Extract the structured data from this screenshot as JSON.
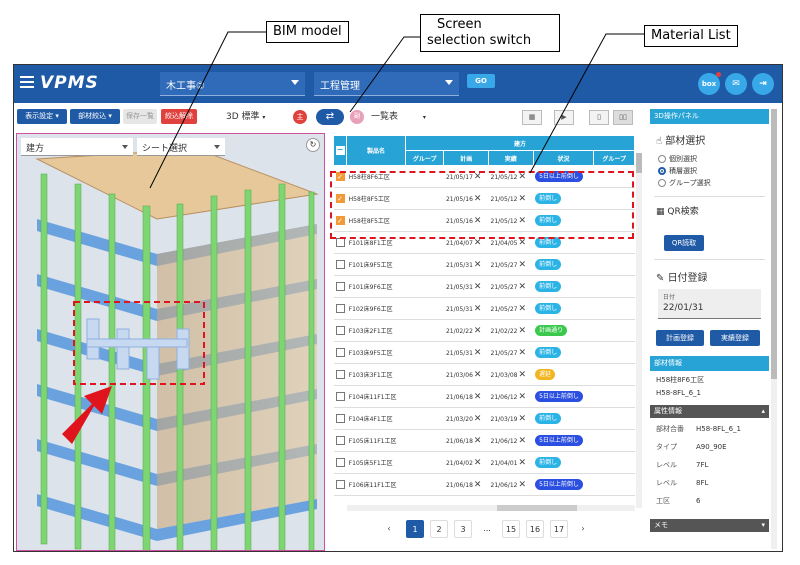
{
  "callouts": {
    "bim": "BIM model",
    "switch_line1": "Screen",
    "switch_line2": "selection switch",
    "material": "Material List"
  },
  "header": {
    "logo": "VPMS",
    "project": "木工事②",
    "module": "工程管理",
    "go": "GO",
    "box": "box"
  },
  "toolbar": {
    "display_settings": "表示設定",
    "member_filter": "部材絞込",
    "save_list": "保存一覧",
    "clear_filter": "絞込解除",
    "view_mode": "3D 標準",
    "badge_main": "主",
    "badge_sub": "副",
    "list_mode": "一覧表"
  },
  "viewport": {
    "dir_select": "建方",
    "sheet_select": "シート選択"
  },
  "table": {
    "group_header": "建方",
    "col_name": "製品名",
    "col_group": "グループ",
    "col_plan": "計画",
    "col_actual": "実績",
    "col_status": "状況",
    "col_group2": "グループ",
    "rows": [
      {
        "name": "H58柱8F6工区",
        "plan": "21/05/17",
        "actual": "21/05/12",
        "status": "5日以上前倒し",
        "checked": true,
        "color": "blue"
      },
      {
        "name": "H58柱8F5工区",
        "plan": "21/05/16",
        "actual": "21/05/12",
        "status": "前倒し",
        "checked": true,
        "color": "cyan"
      },
      {
        "name": "H58柱8F5工区",
        "plan": "21/05/16",
        "actual": "21/05/12",
        "status": "前倒し",
        "checked": true,
        "color": "cyan"
      },
      {
        "name": "F101床8F1工区",
        "plan": "21/04/07",
        "actual": "21/04/05",
        "status": "前倒し",
        "checked": false,
        "color": "cyan"
      },
      {
        "name": "F101床9F5工区",
        "plan": "21/05/31",
        "actual": "21/05/27",
        "status": "前倒し",
        "checked": false,
        "color": "cyan"
      },
      {
        "name": "F101床9F6工区",
        "plan": "21/05/31",
        "actual": "21/05/27",
        "status": "前倒し",
        "checked": false,
        "color": "cyan"
      },
      {
        "name": "F102床9F6工区",
        "plan": "21/05/31",
        "actual": "21/05/27",
        "status": "前倒し",
        "checked": false,
        "color": "cyan"
      },
      {
        "name": "F103床2F1工区",
        "plan": "21/02/22",
        "actual": "21/02/22",
        "status": "計画通り",
        "checked": false,
        "color": "green"
      },
      {
        "name": "F103床9F5工区",
        "plan": "21/05/31",
        "actual": "21/05/27",
        "status": "前倒し",
        "checked": false,
        "color": "cyan"
      },
      {
        "name": "F103床3F1工区",
        "plan": "21/03/06",
        "actual": "21/03/08",
        "status": "遅延",
        "checked": false,
        "color": "yellow"
      },
      {
        "name": "F104床11F1工区",
        "plan": "21/06/18",
        "actual": "21/06/12",
        "status": "5日以上前倒し",
        "checked": false,
        "color": "blue"
      },
      {
        "name": "F104床4F1工区",
        "plan": "21/03/20",
        "actual": "21/03/19",
        "status": "前倒し",
        "checked": false,
        "color": "cyan"
      },
      {
        "name": "F105床11F1工区",
        "plan": "21/06/18",
        "actual": "21/06/12",
        "status": "5日以上前倒し",
        "checked": false,
        "color": "blue"
      },
      {
        "name": "F105床5F1工区",
        "plan": "21/04/02",
        "actual": "21/04/01",
        "status": "前倒し",
        "checked": false,
        "color": "cyan"
      },
      {
        "name": "F106床11F1工区",
        "plan": "21/06/18",
        "actual": "21/06/12",
        "status": "5日以上前倒し",
        "checked": false,
        "color": "blue"
      }
    ]
  },
  "pager": {
    "pages": [
      "1",
      "2",
      "3",
      "...",
      "15",
      "16",
      "17"
    ],
    "current": "1",
    "prev": "‹",
    "next": "›"
  },
  "panel": {
    "title": "3D操作パネル",
    "member_select": "部材選択",
    "radio1": "個別選択",
    "radio2": "積層選択",
    "radio3": "グループ選択",
    "qr_search": "QR検索",
    "qr_read": "QR読取",
    "date_reg": "日付登録",
    "date_label": "日付",
    "date_value": "22/01/31",
    "plan_reg": "計画登録",
    "actual_reg": "実績登録",
    "member_info": "部材情報",
    "info1": "H58柱8F6工区",
    "info2": "H58-8FL_6_1",
    "attr_info": "属性情報",
    "attrs": [
      {
        "k": "部材合番",
        "v": "H58-8FL_6_1"
      },
      {
        "k": "タイプ",
        "v": "A90_90E"
      },
      {
        "k": "レベル",
        "v": "7FL"
      },
      {
        "k": "レベル",
        "v": "8FL"
      },
      {
        "k": "工区",
        "v": "6"
      }
    ],
    "memo": "メモ"
  }
}
